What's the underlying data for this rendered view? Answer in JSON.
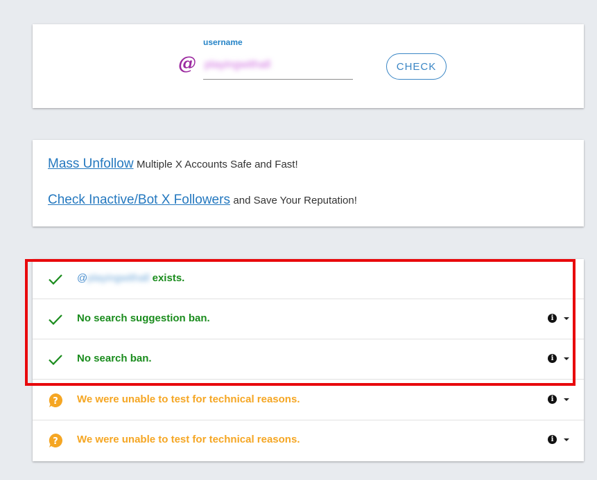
{
  "search": {
    "at_symbol": "@",
    "field_label": "username",
    "username_value": "playingwithall",
    "check_label": "CHECK"
  },
  "promo": {
    "line1_link": "Mass Unfollow",
    "line1_text": "Multiple X Accounts Safe and Fast!",
    "line2_link": "Check Inactive/Bot X Followers",
    "line2_text": "and Save Your Reputation!"
  },
  "results": {
    "exists": {
      "prefix": "@",
      "handle": "playingwithall",
      "suffix": "exists.",
      "status": "ok"
    },
    "items": [
      {
        "text": "No search suggestion ban.",
        "status": "ok",
        "info_icon": "i"
      },
      {
        "text": "No search ban.",
        "status": "ok",
        "info_icon": "i"
      },
      {
        "text": "We were unable to test for technical reasons.",
        "status": "warn",
        "info_icon": "i"
      },
      {
        "text": "We were unable to test for technical reasons.",
        "status": "warn",
        "info_icon": "i"
      }
    ]
  },
  "colors": {
    "accent_blue": "#2478bf",
    "ok_green": "#1a8c1d",
    "warn_orange": "#f5a623",
    "at_purple": "#9c2aa0",
    "highlight_red": "#e8090c"
  },
  "icons": {
    "ok": "check-icon",
    "warn": "question-circle-icon",
    "info": "info-icon",
    "dropdown": "chevron-down-icon"
  }
}
